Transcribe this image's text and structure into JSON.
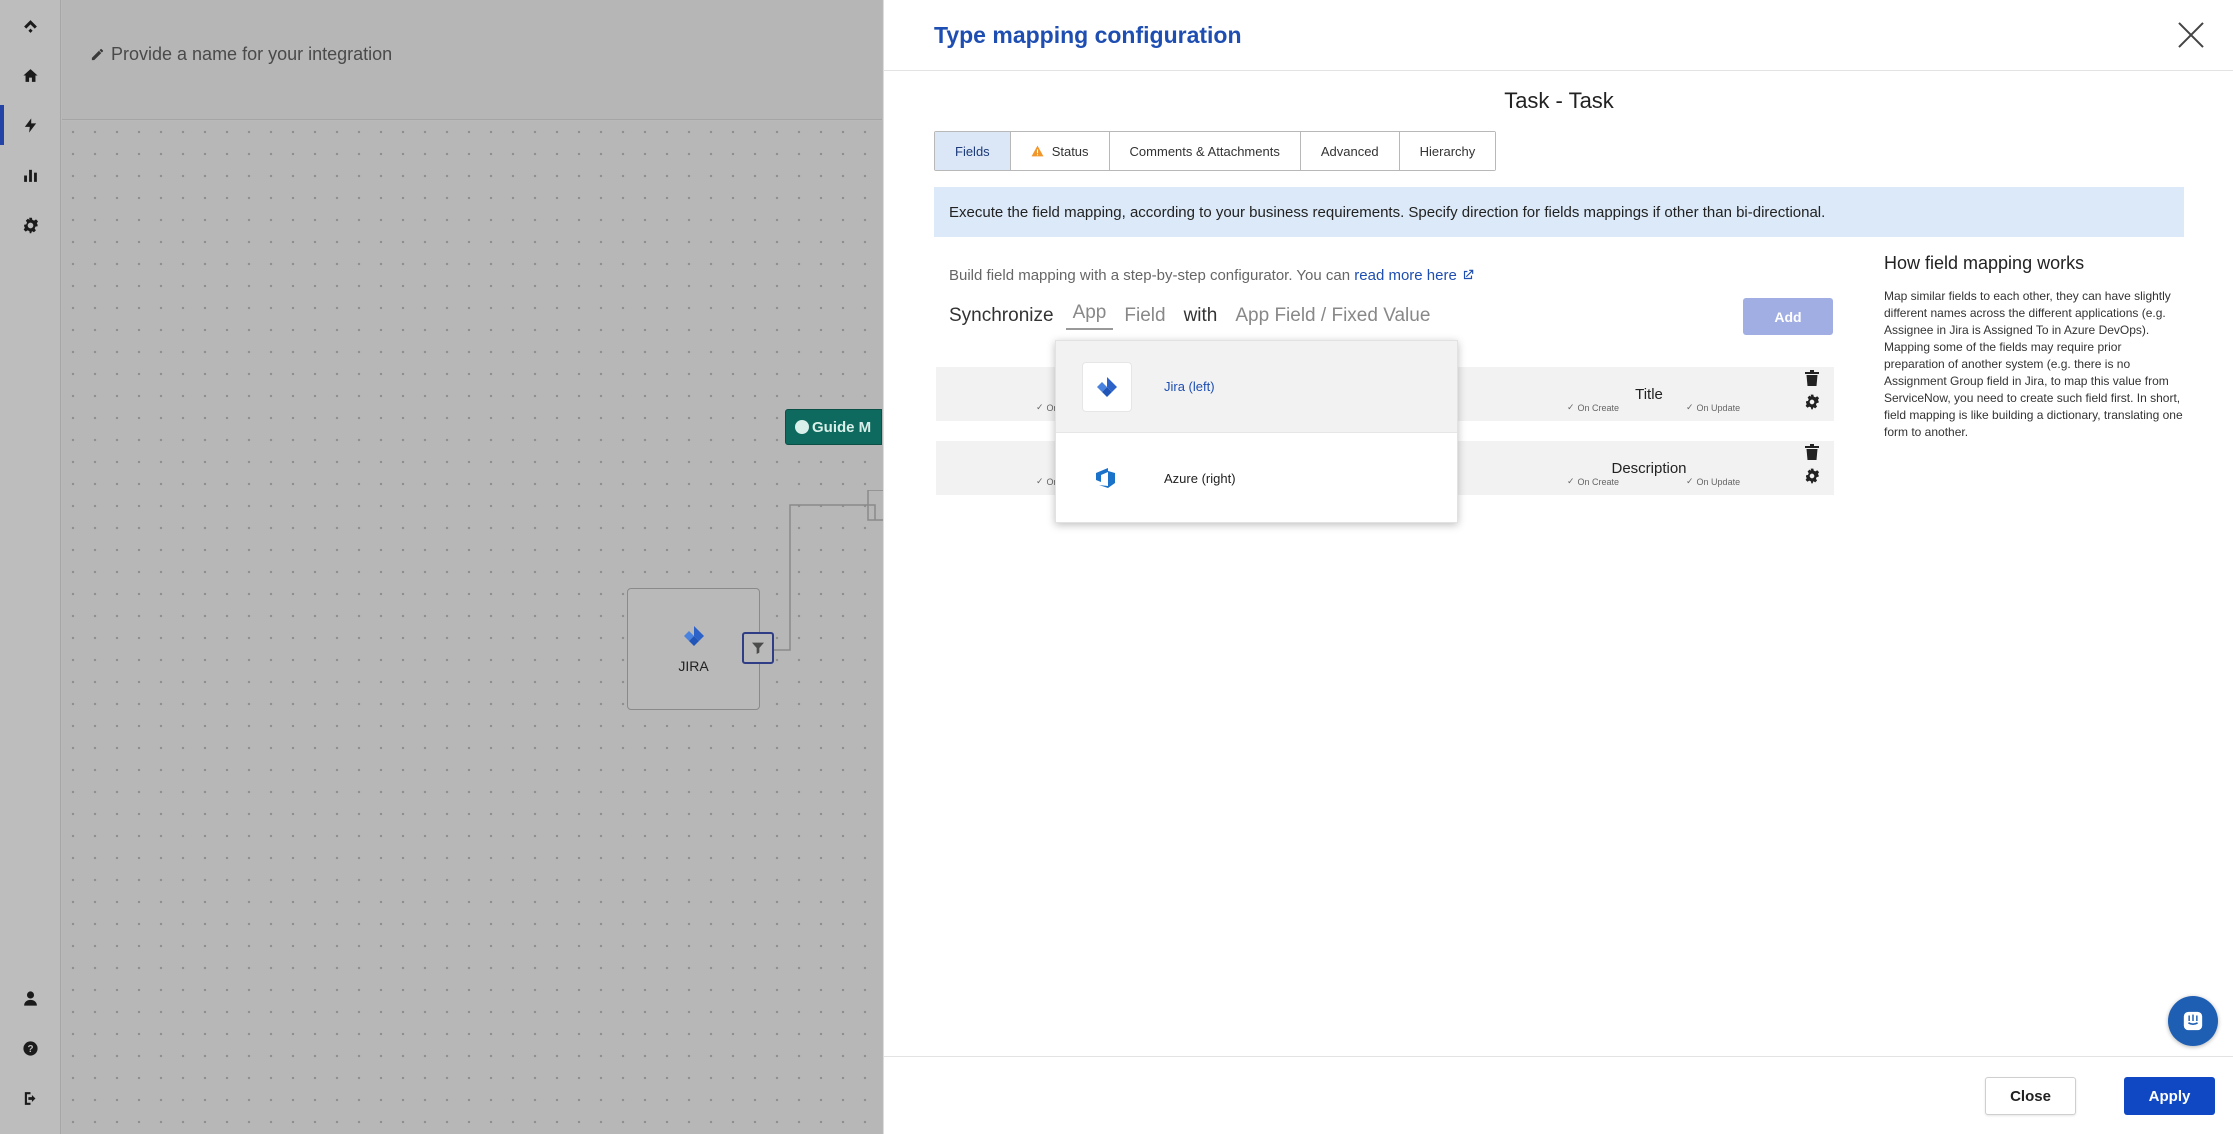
{
  "background": {
    "integration_name_placeholder": "Provide a name for your integration",
    "guide_button_label": "Guide M",
    "node_label": "JIRA"
  },
  "sidebar": {
    "items": [
      {
        "icon": "exalate-logo-icon"
      },
      {
        "icon": "home-icon"
      },
      {
        "icon": "bolt-icon",
        "active": true
      },
      {
        "icon": "chart-icon"
      },
      {
        "icon": "gear-icon"
      },
      {
        "icon": "user-icon"
      },
      {
        "icon": "help-icon"
      },
      {
        "icon": "logout-icon"
      }
    ]
  },
  "modal": {
    "title": "Type mapping configuration",
    "subtitle": "Task - Task",
    "tabs": [
      {
        "label": "Fields",
        "active": true
      },
      {
        "label": "Status",
        "warning": true
      },
      {
        "label": "Comments & Attachments"
      },
      {
        "label": "Advanced"
      },
      {
        "label": "Hierarchy"
      }
    ],
    "info_text": "Execute the field mapping, according to your business requirements. Specify direction for fields mappings if other than bi-directional.",
    "build_text": "Build field mapping with a step-by-step configurator. You can",
    "read_more_link": "read more here",
    "sync_row": {
      "synchronize": "Synchronize",
      "app": "App",
      "field": "Field",
      "with": "with",
      "app_field": "App Field / Fixed Value"
    },
    "add_button": "Add",
    "mappings": [
      {
        "right_field": "Title",
        "left_caption": "On",
        "on_create": "On Create",
        "on_update": "On Update"
      },
      {
        "right_field": "Description",
        "left_caption": "On",
        "on_create": "On Create",
        "on_update": "On Update"
      }
    ],
    "dropdown_options": [
      {
        "label": "Jira (left)",
        "highlighted": true
      },
      {
        "label": "Azure (right)"
      }
    ],
    "help": {
      "title": "How field mapping works",
      "text": "Map similar fields to each other, they can have slightly different names across the different applications (e.g. Assignee in Jira is Assigned To in Azure DevOps). Mapping some of the fields may require prior preparation of another system (e.g. there is no Assignment Group field in Jira, to map this value from ServiceNow, you need to create such field first. In short, field mapping is like building a dictionary, translating one form to another."
    },
    "footer": {
      "close_label": "Close",
      "apply_label": "Apply"
    }
  },
  "colors": {
    "accent": "#1e4eb1",
    "apply": "#1048c4",
    "add_disabled": "#a1aee3",
    "info_bg": "#dbe9f8"
  }
}
